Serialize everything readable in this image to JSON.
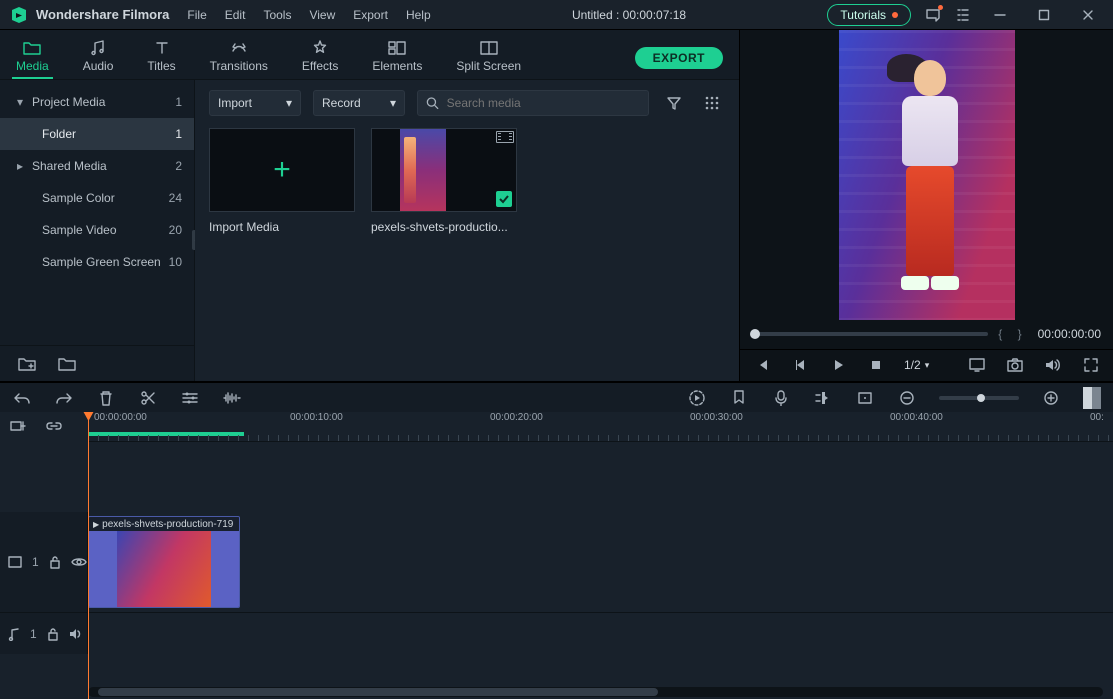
{
  "app": {
    "name": "Wondershare Filmora"
  },
  "menus": [
    "File",
    "Edit",
    "Tools",
    "View",
    "Export",
    "Help"
  ],
  "document": {
    "title": "Untitled : 00:00:07:18"
  },
  "titlebar": {
    "tutorials": "Tutorials"
  },
  "toolTabs": {
    "media": "Media",
    "audio": "Audio",
    "titles": "Titles",
    "transitions": "Transitions",
    "effects": "Effects",
    "elements": "Elements",
    "splitScreen": "Split Screen",
    "export": "EXPORT"
  },
  "sidebar": {
    "items": [
      {
        "label": "Project Media",
        "count": "1",
        "expandable": true,
        "expanded": true
      },
      {
        "label": "Folder",
        "count": "1",
        "active": true,
        "indent": true
      },
      {
        "label": "Shared Media",
        "count": "2",
        "expandable": true
      },
      {
        "label": "Sample Color",
        "count": "24",
        "indent": true
      },
      {
        "label": "Sample Video",
        "count": "20",
        "indent": true
      },
      {
        "label": "Sample Green Screen",
        "count": "10",
        "indent": true
      }
    ]
  },
  "mediaControls": {
    "import": "Import",
    "record": "Record",
    "searchPlaceholder": "Search media"
  },
  "mediaItems": {
    "import": "Import Media",
    "clip1": "pexels-shvets-productio..."
  },
  "preview": {
    "time": "00:00:00:00",
    "ratio": "1/2"
  },
  "timeline": {
    "ticks": [
      "00:00:00:00",
      "00:00:10:00",
      "00:00:20:00",
      "00:00:30:00",
      "00:00:40:00",
      "00:"
    ],
    "clipLabel": "pexels-shvets-production-719",
    "videoTrack": "1",
    "audioTrack": "1"
  }
}
